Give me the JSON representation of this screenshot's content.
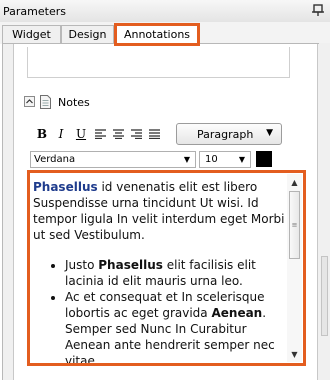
{
  "panel": {
    "title": "Parameters",
    "dock_icon": "pin-icon"
  },
  "tabs": [
    {
      "label": "Widget",
      "selected": false
    },
    {
      "label": "Design",
      "selected": false
    },
    {
      "label": "Annotations",
      "selected": true
    }
  ],
  "notes": {
    "label": "Notes",
    "expanded": true
  },
  "toolbar": {
    "bold": "B",
    "italic": "I",
    "underline": "U",
    "icons": [
      "align-left-icon",
      "align-center-icon",
      "align-right-icon",
      "align-justify-icon"
    ],
    "paragraph": {
      "value": "Paragraph",
      "arrow": "▼"
    }
  },
  "font": {
    "family": "Verdana",
    "size": "10",
    "arrow": "▼",
    "color": "#000000"
  },
  "editor": {
    "p1_kw": "Phasellus",
    "p1_rest": " id venenatis elit est libero Suspendisse urna tincidunt Ut wisi. Id tempor ligula In velit interdum eget Morbi ut sed Vestibulum.",
    "li1_a": "Justo ",
    "li1_kw": "Phasellus",
    "li1_b": " elit facilisis elit lacinia id elit mauris urna leo.",
    "li2_a": "Ac et consequat et In scelerisque lobortis ac eget gravida ",
    "li2_kw": "Aenean",
    "li2_b": ". Semper sed Nunc In Curabitur Aenean ante hendrerit semper nec vitae",
    "scroll_up": "▲",
    "scroll_down": "▼",
    "grip": "≡"
  },
  "colors": {
    "highlight": "#e35d1f",
    "keyword": "#1f3c8d"
  }
}
